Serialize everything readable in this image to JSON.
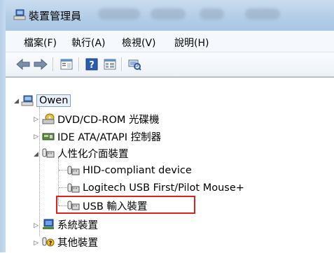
{
  "window": {
    "title": "裝置管理員"
  },
  "menu": [
    {
      "label": "檔案(F)"
    },
    {
      "label": "執行(A)"
    },
    {
      "label": "檢視(V)"
    },
    {
      "label": "說明(H)"
    }
  ],
  "toolbar": {
    "buttons": [
      "back-arrow-icon",
      "forward-arrow-icon",
      "properties-icon",
      "help-icon",
      "view-icon",
      "scan-hardware-icon"
    ]
  },
  "tree": {
    "root": "Owen",
    "categories": [
      {
        "label": "DVD/CD-ROM 光碟機",
        "expanded": false
      },
      {
        "label": "IDE ATA/ATAPI 控制器",
        "expanded": false
      },
      {
        "label": "人性化介面裝置",
        "expanded": true,
        "children": [
          {
            "label": "HID-compliant device"
          },
          {
            "label": "Logitech USB First/Pilot Mouse+"
          },
          {
            "label": "USB 輸入裝置",
            "highlighted": true
          }
        ]
      },
      {
        "label": "系統裝置",
        "expanded": false
      },
      {
        "label": "其他裝置",
        "expanded": false
      }
    ]
  },
  "colors": {
    "highlight_box": "#e02020",
    "titlebar": "#b9d1ea"
  }
}
